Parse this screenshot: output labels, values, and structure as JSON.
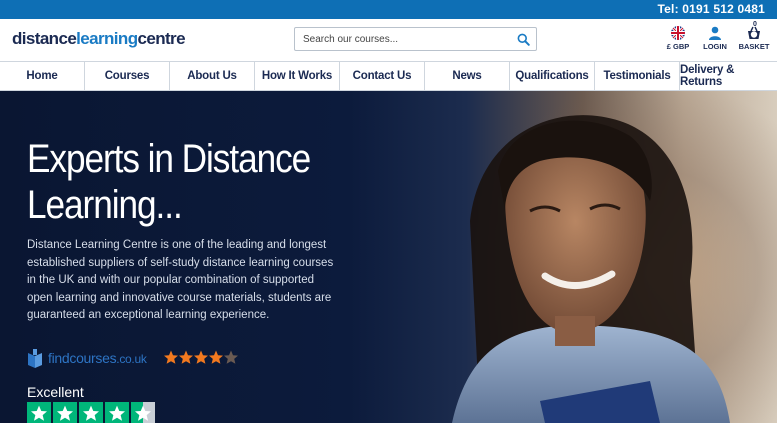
{
  "topbar": {
    "tel": "Tel: 0191 512 0481"
  },
  "header": {
    "logo": {
      "part1": "distance",
      "part2": "learning",
      "part3": "centre"
    },
    "search": {
      "placeholder": "Search our courses...",
      "value": ""
    },
    "currency": {
      "label": "£ GBP",
      "icon": "uk-flag-icon"
    },
    "login": {
      "label": "LOGIN",
      "icon": "user-icon"
    },
    "basket": {
      "label": "BASKET",
      "count": "0",
      "icon": "basket-icon"
    }
  },
  "nav": {
    "items": [
      {
        "label": "Home"
      },
      {
        "label": "Courses"
      },
      {
        "label": "About Us"
      },
      {
        "label": "How It Works"
      },
      {
        "label": "Contact Us"
      },
      {
        "label": "News"
      },
      {
        "label": "Qualifications"
      },
      {
        "label": "Testimonials"
      },
      {
        "label": "Delivery & Returns"
      }
    ]
  },
  "hero": {
    "title": "Experts in Distance Learning...",
    "body": "Distance Learning Centre is one of the leading and longest established suppliers of self-study distance learning courses in the UK and with our popular combination of supported open learning and innovative course materials, students are guaranteed an exceptional learning experience.",
    "findcourses": {
      "name": "findcourses",
      "tld": ".co.uk",
      "rating": 4.5,
      "max": 5
    },
    "trustpilot": {
      "label": "Excellent",
      "rating": 4.5,
      "max": 5
    }
  },
  "colors": {
    "topbar": "#0e6fb5",
    "navy": "#1b2a52",
    "accent_blue": "#1a7bc4",
    "trustpilot_green": "#00b67a",
    "star_orange": "#f2791f"
  }
}
